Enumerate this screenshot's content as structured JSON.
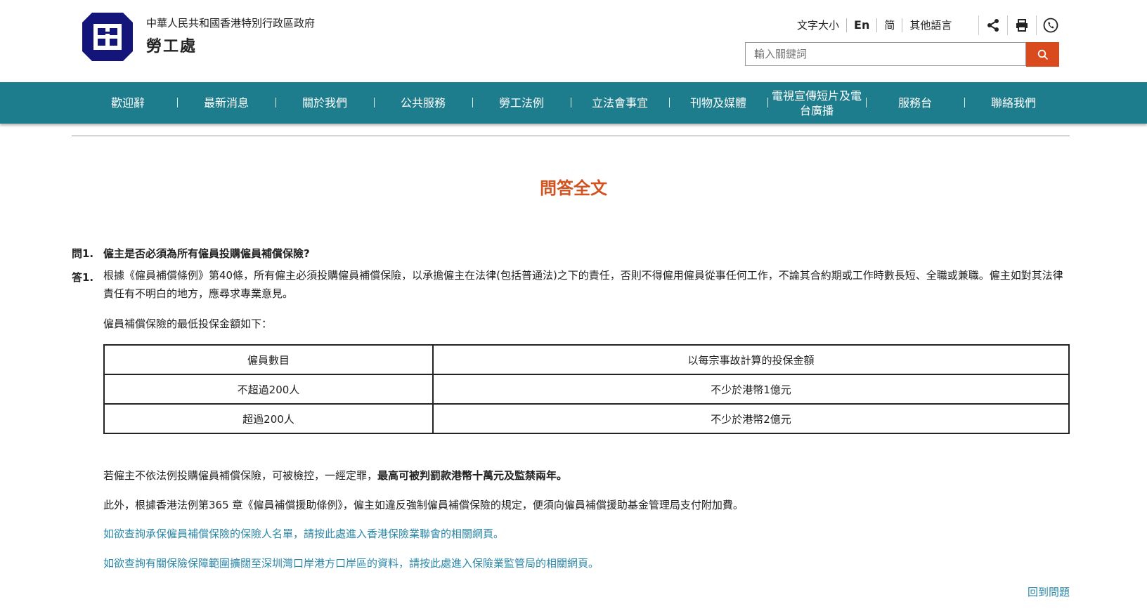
{
  "header": {
    "gov_name": "中華人民共和國香港特別行政區政府",
    "dept_name": "勞工處",
    "toolbar": [
      "文字大小",
      "En",
      "简",
      "其他語言"
    ],
    "icons": [
      "share-icon",
      "print-icon",
      "phone-icon"
    ],
    "search_placeholder": "輸入關鍵詞"
  },
  "nav": {
    "items": [
      "歡迎辭",
      "最新消息",
      "關於我們",
      "公共服務",
      "勞工法例",
      "立法會事宜",
      "刊物及媒體",
      "電視宣傳短片及電台廣播",
      "服務台",
      "聯絡我們"
    ]
  },
  "page_title": "問答全文",
  "qa": {
    "q_num": "問1.",
    "question": "僱主是否必須為所有僱員投購僱員補償保險?",
    "a_num": "答1.",
    "answer": "根據《僱員補償條例》第40條，所有僱主必須投購僱員補償保險，以承擔僱主在法律(包括普通法)之下的責任，否則不得僱用僱員從事任何工作，不論其合約期或工作時數長短、全職或兼職。僱主如對其法律責任有不明白的地方，應尋求專業意見。",
    "table_intro": "僱員補償保險的最低投保金額如下：",
    "table": {
      "headers": [
        "僱員數目",
        "以每宗事故計算的投保金額"
      ],
      "rows": [
        [
          "不超過200人",
          "不少於港幣1億元"
        ],
        [
          "超過200人",
          "不少於港幣2億元"
        ]
      ]
    },
    "penalty_prefix": "若僱主不依法例投購僱員補償保險，可被檢控，一經定罪，",
    "penalty_bold": "最高可被判罰款港幣十萬元及監禁兩年。",
    "levy": "此外，根據香港法例第365 章《僱員補償援助條例》，僱主如違反強制僱員補償保險的規定，便須向僱員補償援助基金管理局支付附加費。",
    "link1": "如欲查詢承保僱員補償保險的保險人名單，請按此處進入香港保險業聯會的相關網頁。",
    "link2": "如欲查詢有關保險保障範圍擴闊至深圳灣口岸港方口岸區的資料，請按此處進入保險業監管局的相關網頁。",
    "back_link": "回到問題"
  },
  "colors": {
    "nav_bg": "#1d7d8d",
    "accent": "#d2531f",
    "search_btn": "#d94a1e",
    "link": "#2b87a8",
    "logo": "#14157a"
  }
}
